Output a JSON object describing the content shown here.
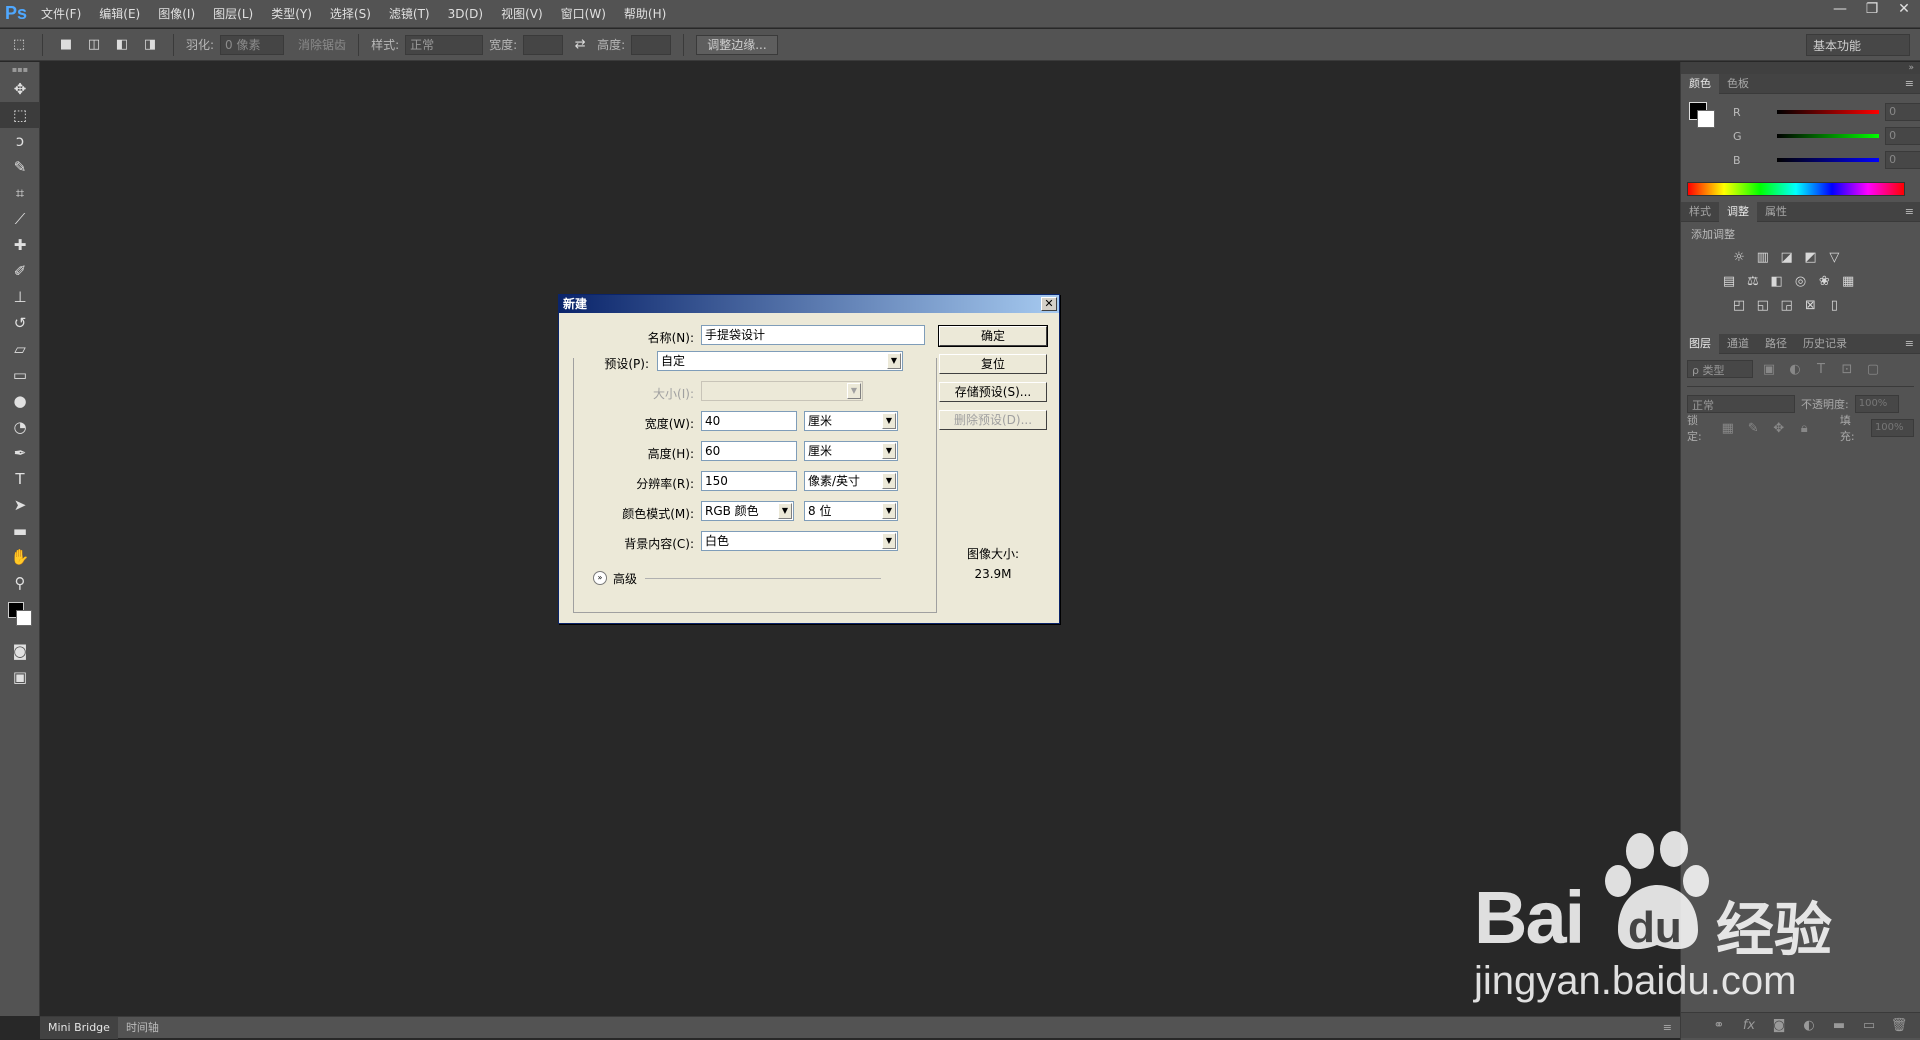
{
  "app": {
    "logo": "Ps",
    "menu": [
      "文件(F)",
      "编辑(E)",
      "图像(I)",
      "图层(L)",
      "类型(Y)",
      "选择(S)",
      "滤镜(T)",
      "3D(D)",
      "视图(V)",
      "窗口(W)",
      "帮助(H)"
    ],
    "window_controls": [
      "—",
      "❐",
      "✕"
    ]
  },
  "options": {
    "feather_label": "羽化:",
    "feather_value": "0 像素",
    "antialias_label": "消除锯齿",
    "style_label": "样式:",
    "style_value": "正常",
    "width_label": "宽度:",
    "height_label": "高度:",
    "refine_button": "调整边缘...",
    "workspace": "基本功能"
  },
  "bottom_tabs": [
    "Mini Bridge",
    "时间轴"
  ],
  "panels": {
    "color_tabs": [
      "颜色",
      "色板"
    ],
    "rgb": [
      {
        "label": "R",
        "value": "0",
        "color": "#ff0000"
      },
      {
        "label": "G",
        "value": "0",
        "color": "#00ff00"
      },
      {
        "label": "B",
        "value": "0",
        "color": "#0000ff"
      }
    ],
    "adjust_tabs": [
      "样式",
      "调整",
      "属性"
    ],
    "adjust_title": "添加调整",
    "layer_tabs": [
      "图层",
      "通道",
      "路径",
      "历史记录"
    ],
    "layer_filter": "ρ 类型",
    "blend_mode": "正常",
    "opacity_label": "不透明度:",
    "opacity_value": "100%",
    "lock_label": "锁定:",
    "fill_label": "填充:",
    "fill_value": "100%"
  },
  "dialog": {
    "title": "新建",
    "close": "✕",
    "name_label": "名称(N):",
    "name_value": "手提袋设计",
    "preset_label": "预设(P):",
    "preset_value": "自定",
    "size_label": "大小(I):",
    "width_label": "宽度(W):",
    "width_value": "40",
    "width_unit": "厘米",
    "height_label": "高度(H):",
    "height_value": "60",
    "height_unit": "厘米",
    "resolution_label": "分辨率(R):",
    "resolution_value": "150",
    "resolution_unit": "像素/英寸",
    "color_mode_label": "颜色模式(M):",
    "color_mode_value": "RGB 颜色",
    "bit_depth": "8 位",
    "background_label": "背景内容(C):",
    "background_value": "白色",
    "advanced_label": "高级",
    "ok_button": "确定",
    "reset_button": "复位",
    "save_preset_button": "存储预设(S)...",
    "delete_preset_button": "删除预设(D)...",
    "image_size_label": "图像大小:",
    "image_size_value": "23.9M"
  },
  "watermark": {
    "brand": "Bai",
    "brand_du": "du",
    "suffix": "经验",
    "url": "jingyan.baidu.com"
  }
}
